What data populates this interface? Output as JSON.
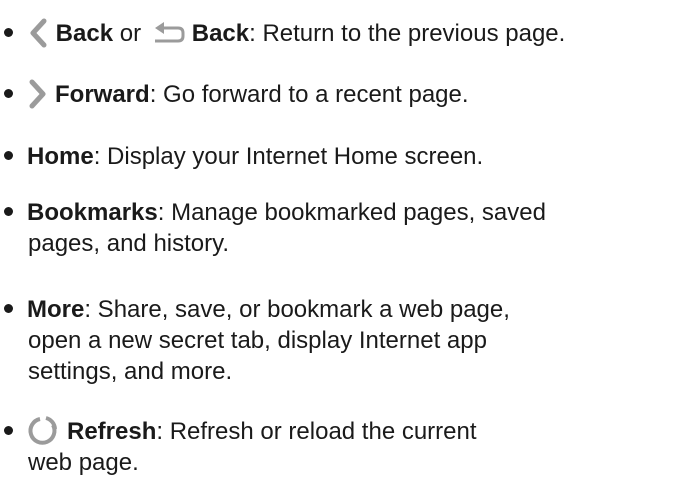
{
  "items": [
    {
      "parts": [
        "Back",
        " or ",
        "Back",
        ": Return to the previous page."
      ],
      "icons": [
        "chevron-left-icon",
        "return-arrow-icon"
      ]
    },
    {
      "parts": [
        "Forward",
        ": Go forward to a recent page."
      ],
      "icons": [
        "chevron-right-icon"
      ]
    },
    {
      "parts": [
        "Home",
        ": Display your Internet Home screen."
      ]
    },
    {
      "parts": [
        "Bookmarks",
        ": Manage bookmarked pages, saved",
        "pages, and history."
      ]
    },
    {
      "parts": [
        "More",
        ": Share, save, or bookmark a web page,",
        "open a new secret tab, display Internet app",
        "settings, and more."
      ]
    },
    {
      "parts": [
        "Refresh",
        ": Refresh or reload the current",
        "web page."
      ],
      "icons": [
        "refresh-icon"
      ]
    }
  ],
  "colors": {
    "text": "#1a1a1a",
    "icon_gray": "#9b9b9b"
  }
}
